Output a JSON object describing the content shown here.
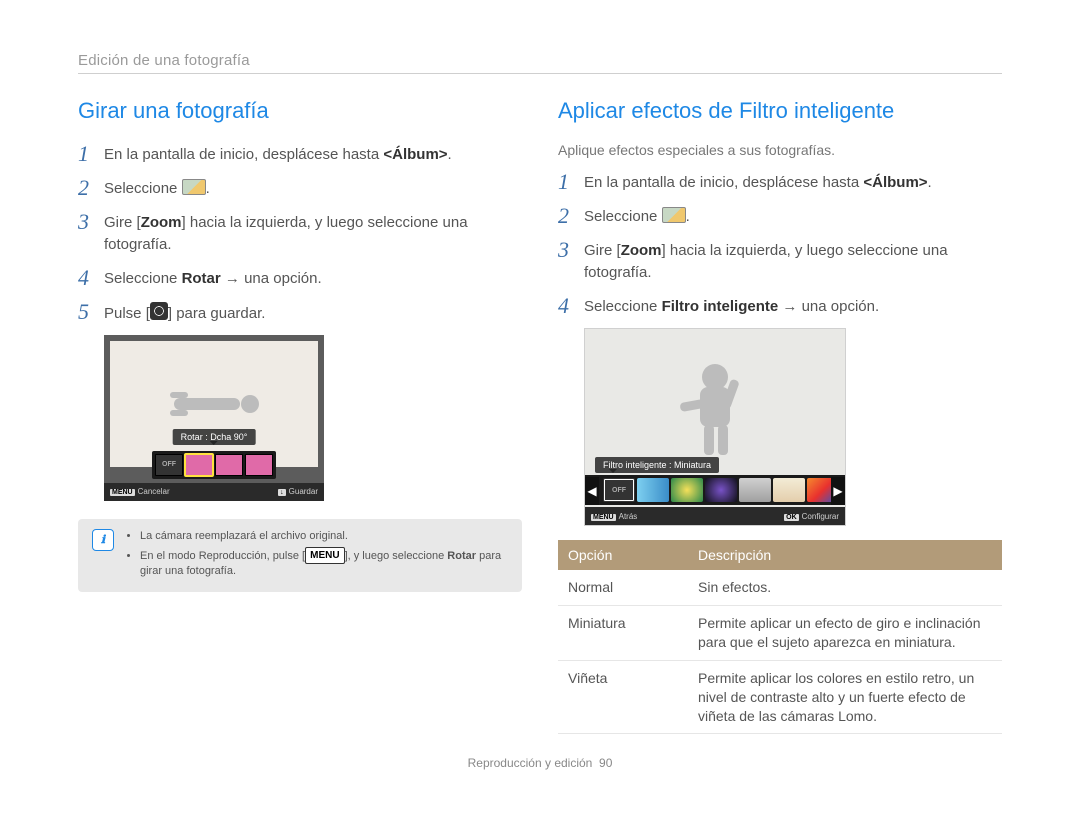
{
  "breadcrumb": "Edición de una fotografía",
  "left": {
    "title": "Girar una fotografía",
    "steps": [
      {
        "pre": "En la pantalla de inicio, desplácese hasta ",
        "bold": "<Álbum>",
        "post": "."
      },
      {
        "pre": "Seleccione ",
        "icon": "edit-icon",
        "post": "."
      },
      {
        "pre": "Gire [",
        "bold": "Zoom",
        "post": "] hacia la izquierda, y luego seleccione una fotografía."
      },
      {
        "pre": "Seleccione ",
        "bold": "Rotar",
        "post": " → una opción."
      },
      {
        "pre": "Pulse [",
        "icon": "macro-icon",
        "post": "] para guardar."
      }
    ],
    "screen": {
      "tooltip": "Rotar : Dcha 90°",
      "off_label": "OFF",
      "footer_left_key": "MENU",
      "footer_left": "Cancelar",
      "footer_right_icon": "↓",
      "footer_right": "Guardar"
    },
    "note": {
      "items": [
        "La cámara reemplazará el archivo original.",
        "En el modo Reproducción, pulse [MENU], y luego seleccione Rotar para girar una fotografía."
      ],
      "menu_key": "MENU",
      "bold_word": "Rotar"
    }
  },
  "right": {
    "title": "Aplicar efectos de Filtro inteligente",
    "intro": "Aplique efectos especiales a sus fotografías.",
    "steps": [
      {
        "pre": "En la pantalla de inicio, desplácese hasta ",
        "bold": "<Álbum>",
        "post": "."
      },
      {
        "pre": "Seleccione ",
        "icon": "edit-icon",
        "post": "."
      },
      {
        "pre": "Gire [",
        "bold": "Zoom",
        "post": "] hacia la izquierda, y luego seleccione una fotografía."
      },
      {
        "pre": "Seleccione ",
        "bold": "Filtro inteligente",
        "post": " → una opción."
      }
    ],
    "screen": {
      "tooltip": "Filtro inteligente : Miniatura",
      "off_label": "OFF",
      "footer_left_key": "MENU",
      "footer_left": "Atrás",
      "footer_right_key": "OK",
      "footer_right": "Configurar"
    },
    "table": {
      "headers": {
        "option": "Opción",
        "desc": "Descripción"
      },
      "rows": [
        {
          "option": "Normal",
          "desc": "Sin efectos."
        },
        {
          "option": "Miniatura",
          "desc": "Permite aplicar un efecto de giro e inclinación para que el sujeto aparezca en miniatura."
        },
        {
          "option": "Viñeta",
          "desc": "Permite aplicar los colores en estilo retro, un nivel de contraste alto y un fuerte efecto de viñeta de las cámaras Lomo."
        }
      ]
    }
  },
  "footer": {
    "section": "Reproducción y edición",
    "page": "90"
  }
}
